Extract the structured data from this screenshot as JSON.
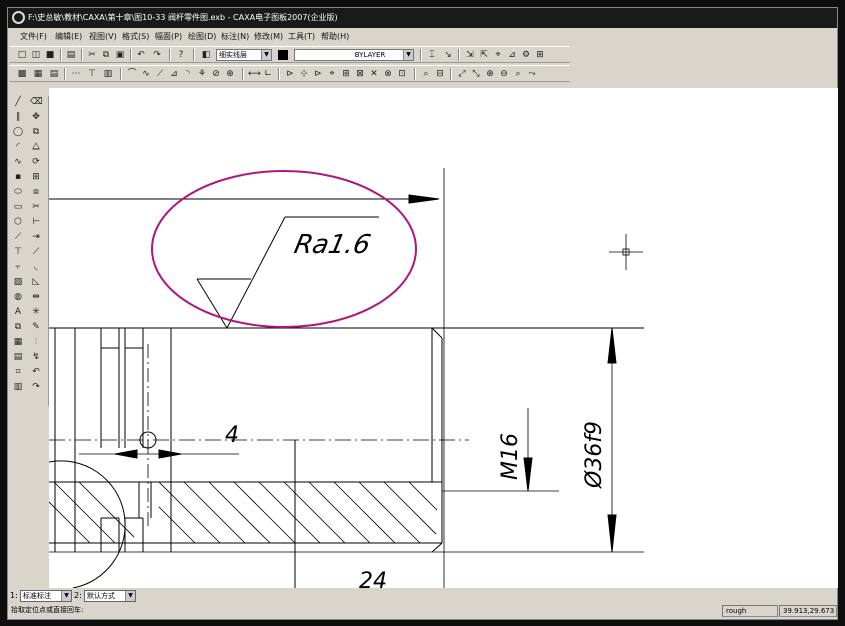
{
  "window": {
    "title": "F:\\史总敏\\教材\\CAXA\\第十章\\图10-33 阀杆零件图.exb - CAXA电子图板2007(企业版)"
  },
  "menu": {
    "items": [
      "文件(F)",
      "编辑(E)",
      "视图(V)",
      "格式(S)",
      "幅面(P)",
      "绘图(D)",
      "标注(N)",
      "修改(M)",
      "工具(T)",
      "帮助(H)"
    ]
  },
  "toolbar": {
    "layer_value": "细实线层",
    "linetype_value": "BYLAYER",
    "color_hex": "#000000"
  },
  "drawing": {
    "roughness_label": "Ra1.6",
    "dim_4": "4",
    "dim_m16": "M16",
    "dim_phi36": "Ø36f9",
    "dim_24": "24",
    "highlight_color": "#b0157c"
  },
  "propmenu": {
    "label1": "1:",
    "value1": "标准标注",
    "label2": "2:",
    "value2": "默认方式"
  },
  "status": {
    "prompt": "拾取定位点或直接回车:",
    "mode": "rough",
    "coords": "39.913,29.673"
  }
}
